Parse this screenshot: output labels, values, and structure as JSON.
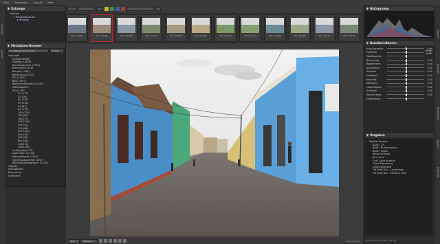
{
  "menubar": {
    "items": [
      "Datei",
      "Bearbeiten",
      "Ansicht",
      "Hilfe"
    ]
  },
  "left_sidebar_tabs": [
    "Lichttisch",
    "Import"
  ],
  "right_sidebar_tabs": [
    "Export",
    "Drucken",
    "Entwickeln",
    "Karten",
    "Diashow"
  ],
  "catalog_panel": {
    "title": "Kataloge",
    "items": [
      "Bilder",
      "Reisefotos-Kuba",
      "Trinidad"
    ]
  },
  "metadata_panel": {
    "title": "Metadaten-Browser",
    "buttons": [
      "Alle Kataloge durchsuchen",
      "Suchen"
    ],
    "tree": [
      "Farbprofil",
      "Aufnahmezeit",
      "Objektiv (2400)",
      "Kamerabesitzer (1785)",
      "Brennweite (720)",
      "Blende (1430)",
      "Belichtung (1207)",
      "ISO (1502)",
      "Blitz (1757)",
      "Belichtungsmodus (1205)",
      "Weißabgleich",
      "ISO (1402)",
      "25 (177)",
      "32 (18)",
      "40 (142)",
      "50 (218)",
      "64 (81)",
      "80 (179)",
      "100 (230)",
      "125 (81)",
      "160 (73)",
      "200 (116)",
      "250 (40)",
      "320 (88)",
      "400 (112)",
      "500 (22)",
      "640 (64)",
      "800 (58)",
      "1000 (9)",
      "1600 (16)",
      "Lichtquelle (110)",
      "Light Source (130)",
      "Messmethode (1230)",
      "Verschlusspriorität (1307)",
      "Belichtungsprogramm (1250)",
      "Objekte",
      "Schlagworte",
      "Bewertung",
      "Sternchen"
    ]
  },
  "filmstrip": {
    "labels": [
      "IMG_1234.JPG",
      "IMG_1235.JPG",
      "IMG_1236.JPG",
      "IMG_1237.JPG",
      "IMG_1238.JPG",
      "IMG_1239.JPG",
      "IMG_1240.JPG",
      "IMG_1241.JPG",
      "IMG_1242.JPG",
      "IMG_1243.JPG",
      "IMG_1244.JPG",
      "IMG_1245.JPG"
    ],
    "selected_index": 1
  },
  "histogram_panel": {
    "title": "Histogramm"
  },
  "basic_panel": {
    "title": "Basiskorrekturen",
    "rows": [
      {
        "label": "Auto-Korrektur",
        "value": "Auto"
      },
      {
        "label": "Profil/Stil",
        "value": "Farbe: kräft."
      },
      {
        "label": "Weißabgleich",
        "value": ""
      },
      {
        "label": "Belichtung",
        "value": "0.00"
      },
      {
        "label": "Wiederherst.",
        "value": "0.00"
      },
      {
        "label": "Aufhelllicht",
        "value": "0.00"
      },
      {
        "label": "Schwarz",
        "value": "0.00"
      },
      {
        "label": "Helligkeit",
        "value": "0.00"
      },
      {
        "label": "Kontrast",
        "value": "0.00"
      },
      {
        "label": "Sättigung",
        "value": "0.00"
      },
      {
        "label": "Lebendigkeit",
        "value": "0.00"
      },
      {
        "label": "Schärfen",
        "value": "0.00"
      },
      {
        "label": "Rauschreduz.",
        "value": "0.00"
      },
      {
        "label": "Farbschema",
        "value": ""
      }
    ]
  },
  "presets_panel": {
    "title": "Vorgaben",
    "items": [
      "Default Presets",
      "B&W - 25",
      "B&W - IR Simulation",
      "B&W - Sepia",
      "Bleach Bypass",
      "Blue Tone",
      "Cold Color Balance",
      "Cross Processing",
      "Desat Selective",
      "Tilt Shift Blur - Landscape",
      "Tilt Shift Blur - Medium Tone"
    ]
  },
  "bottombar": {
    "zoom_mode": "Einpassen",
    "info": "IMG_1235.JPG"
  },
  "status": {
    "right": "Gespeichert um 09:11:36 Uhr"
  }
}
